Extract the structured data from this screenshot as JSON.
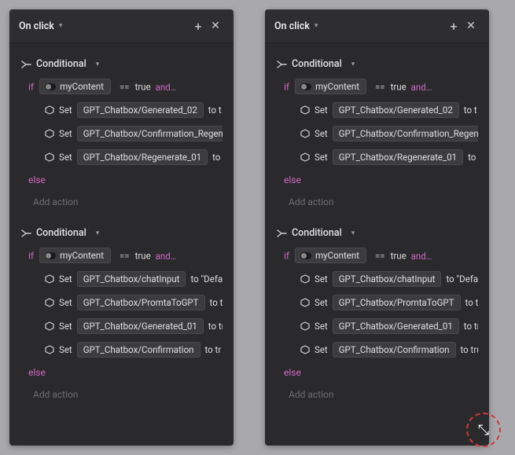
{
  "panels": [
    {
      "header": {
        "title": "On click"
      },
      "blocks": [
        {
          "label": "Conditional",
          "if": {
            "kw": "if",
            "var": "myContent",
            "op": "==",
            "val": "true",
            "and": "and…"
          },
          "actions": [
            {
              "set": "Set",
              "target": "GPT_Chatbox/Generated_02",
              "to": "to t"
            },
            {
              "set": "Set",
              "target": "GPT_Chatbox/Confirmation_Regen",
              "to": ""
            },
            {
              "set": "Set",
              "target": "GPT_Chatbox/Regenerate_01",
              "to": "to f"
            }
          ],
          "else": "else",
          "add": "Add action"
        },
        {
          "label": "Conditional",
          "if": {
            "kw": "if",
            "var": "myContent",
            "op": "==",
            "val": "true",
            "and": "and…"
          },
          "actions": [
            {
              "set": "Set",
              "target": "GPT_Chatbox/chatInput",
              "to": "to \"Defa"
            },
            {
              "set": "Set",
              "target": "GPT_Chatbox/PromtaToGPT",
              "to": "to tr"
            },
            {
              "set": "Set",
              "target": "GPT_Chatbox/Generated_01",
              "to": "to tr"
            },
            {
              "set": "Set",
              "target": "GPT_Chatbox/Confirmation",
              "to": "to tr"
            }
          ],
          "else": "else",
          "add": "Add action"
        }
      ]
    },
    {
      "header": {
        "title": "On click"
      },
      "blocks": [
        {
          "label": "Conditional",
          "if": {
            "kw": "if",
            "var": "myContent",
            "op": "==",
            "val": "true",
            "and": "and…"
          },
          "actions": [
            {
              "set": "Set",
              "target": "GPT_Chatbox/Generated_02",
              "to": "to t"
            },
            {
              "set": "Set",
              "target": "GPT_Chatbox/Confirmation_Regen",
              "to": ""
            },
            {
              "set": "Set",
              "target": "GPT_Chatbox/Regenerate_01",
              "to": "to f"
            }
          ],
          "else": "else",
          "add": "Add action"
        },
        {
          "label": "Conditional",
          "if": {
            "kw": "if",
            "var": "myContent",
            "op": "==",
            "val": "true",
            "and": "and…"
          },
          "actions": [
            {
              "set": "Set",
              "target": "GPT_Chatbox/chatInput",
              "to": "to \"Defa"
            },
            {
              "set": "Set",
              "target": "GPT_Chatbox/PromtaToGPT",
              "to": "to tr"
            },
            {
              "set": "Set",
              "target": "GPT_Chatbox/Generated_01",
              "to": "to tr"
            },
            {
              "set": "Set",
              "target": "GPT_Chatbox/Confirmation",
              "to": "to tru"
            }
          ],
          "else": "else",
          "add": "Add action"
        }
      ]
    }
  ]
}
